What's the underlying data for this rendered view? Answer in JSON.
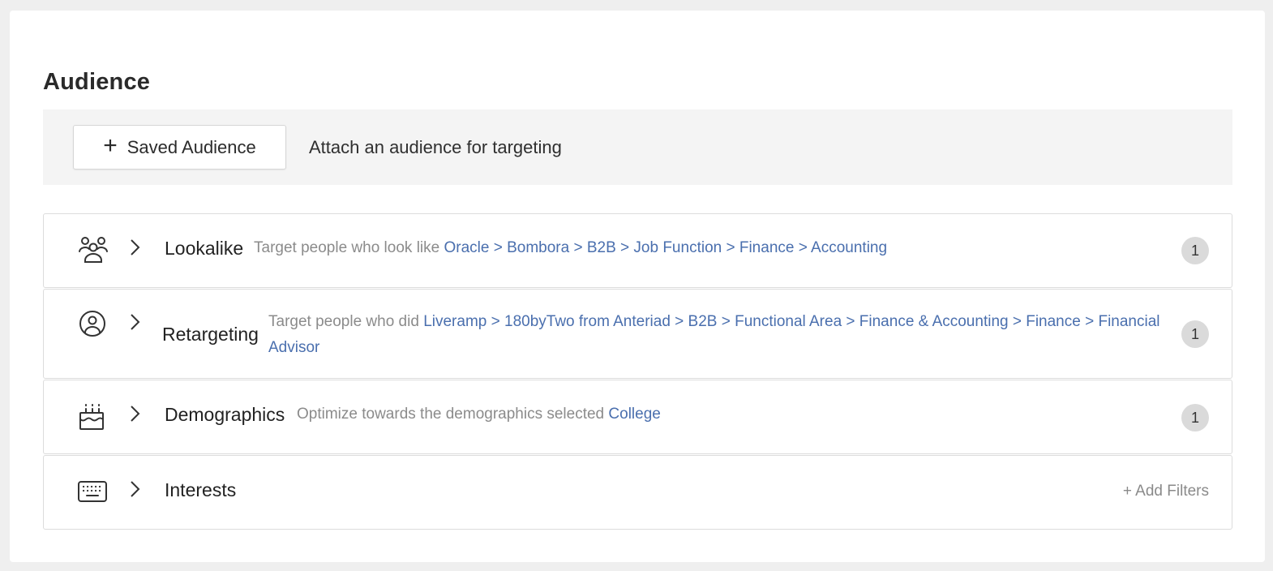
{
  "section": {
    "title": "Audience"
  },
  "saved_audience": {
    "button_label": "Saved Audience",
    "button_icon": "plus-icon",
    "description": "Attach an audience for targeting"
  },
  "colors": {
    "link": "#4a6fae",
    "muted": "#8b8b8b",
    "badge_bg": "#dadada",
    "bar_bg": "#f4f4f4"
  },
  "rows": [
    {
      "icon": "people-group-icon",
      "name": "Lookalike",
      "description": "Target people who look like",
      "path": "Oracle > Bombora > B2B > Job Function > Finance > Accounting",
      "count": "1"
    },
    {
      "icon": "user-circle-icon",
      "name": "Retargeting",
      "description": "Target people who did",
      "path": "Liveramp > 180byTwo from Anteriad > B2B > Functional Area > Finance & Accounting > Finance > Financial Advisor",
      "count": "1"
    },
    {
      "icon": "birthday-cake-icon",
      "name": "Demographics",
      "description": "Optimize towards the demographics selected",
      "path": "College",
      "count": "1"
    },
    {
      "icon": "keyboard-icon",
      "name": "Interests",
      "description": "",
      "path": "",
      "action": "+ Add Filters"
    }
  ]
}
